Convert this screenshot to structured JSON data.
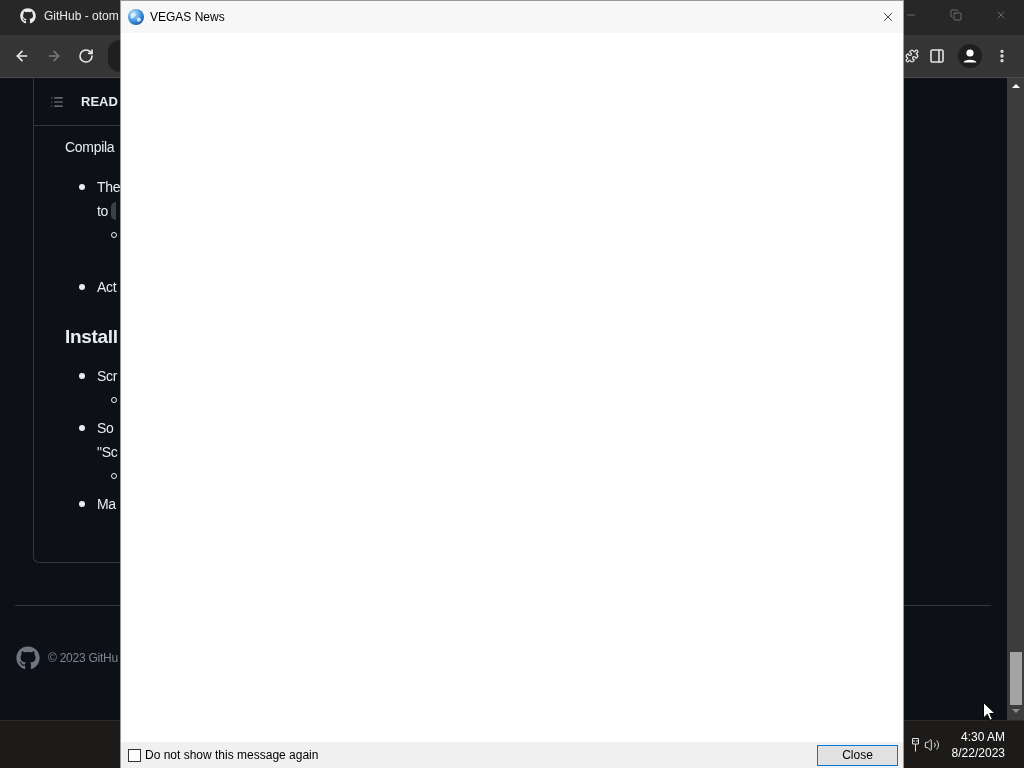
{
  "browser": {
    "tab": {
      "title": "GitHub - otom"
    },
    "window_controls": [
      {
        "kind": "minimize"
      },
      {
        "kind": "restore"
      },
      {
        "kind": "close"
      }
    ],
    "nav_buttons": [
      {
        "kind": "back",
        "disabled": false
      },
      {
        "kind": "forward",
        "disabled": true
      },
      {
        "kind": "reload",
        "disabled": false
      }
    ],
    "toolbar_icons": [
      {
        "kind": "extensions"
      },
      {
        "kind": "side-panel"
      },
      {
        "kind": "profile"
      },
      {
        "kind": "menu"
      }
    ]
  },
  "readme": {
    "header": "READ",
    "blocks": [
      {
        "kind": "paragraph",
        "text": "Compila"
      },
      {
        "kind": "list",
        "items": [
          {
            "lines": [
              "The",
              "to"
            ],
            "inline_code": true,
            "children": [
              {
                "wrapped": true
              }
            ]
          },
          {
            "lines": [
              "Act"
            ]
          }
        ]
      },
      {
        "kind": "heading",
        "text": "Install"
      },
      {
        "kind": "list",
        "items": [
          {
            "lines": [
              "Scr"
            ],
            "children": [
              {
                "wrapped": false
              }
            ]
          },
          {
            "lines": [
              "So",
              "\"Sc"
            ],
            "children": [
              {
                "wrapped": false
              }
            ]
          },
          {
            "lines": [
              "Ma"
            ]
          }
        ]
      }
    ]
  },
  "footer": {
    "copyright": "© 2023 GitHu"
  },
  "taskbar": {
    "tray_icons": [
      {
        "kind": "network"
      },
      {
        "kind": "volume"
      }
    ],
    "time": "4:30 AM",
    "date": "8/22/2023"
  },
  "dialog": {
    "title": "VEGAS News",
    "dont_show_again": {
      "label": "Do not show this message again",
      "checked": false
    },
    "buttons": [
      "Close"
    ]
  }
}
